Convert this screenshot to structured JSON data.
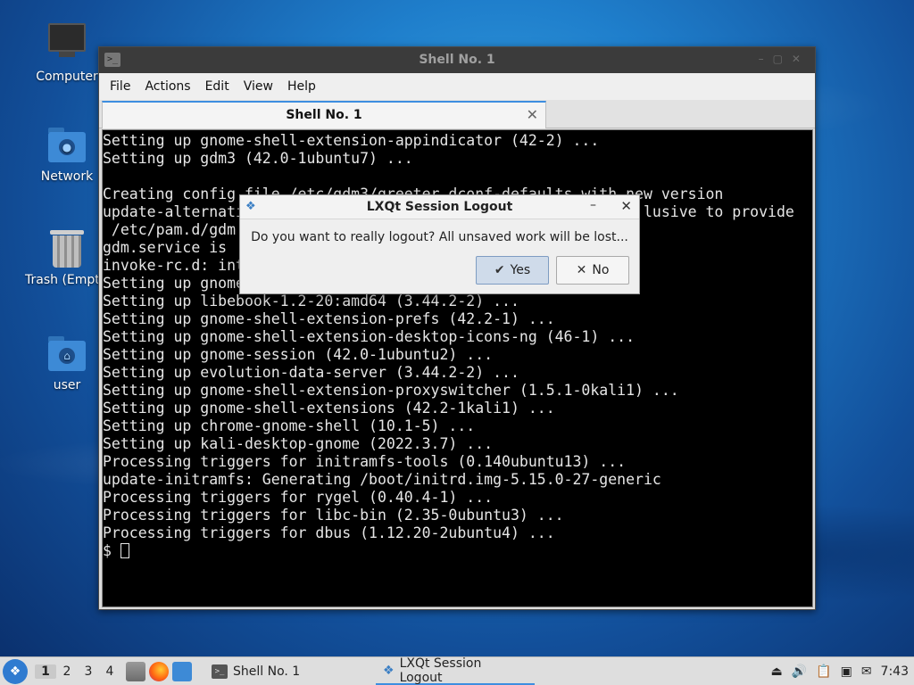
{
  "desktop": {
    "icons": [
      {
        "label": "Computer"
      },
      {
        "label": "Network"
      },
      {
        "label": "Trash (Empty)"
      },
      {
        "label": "user"
      }
    ]
  },
  "terminal": {
    "title": "Shell No. 1",
    "menu": [
      "File",
      "Actions",
      "Edit",
      "View",
      "Help"
    ],
    "tab_label": "Shell No. 1",
    "lines": [
      "Setting up gnome-shell-extension-appindicator (42-2) ...",
      "Setting up gdm3 (42.0-1ubuntu7) ...",
      "",
      "Creating config file /etc/gdm3/greeter.dconf-defaults with new version",
      "update-alternatives: using /etc/gdm3 ...                     lusive to provide",
      " /etc/pam.d/gdm",
      "gdm.service is",
      "invoke-rc.d: int",
      "Setting up gnome",
      "Setting up libebook-1.2-20:amd64 (3.44.2-2) ...",
      "Setting up gnome-shell-extension-prefs (42.2-1) ...",
      "Setting up gnome-shell-extension-desktop-icons-ng (46-1) ...",
      "Setting up gnome-session (42.0-1ubuntu2) ...",
      "Setting up evolution-data-server (3.44.2-2) ...",
      "Setting up gnome-shell-extension-proxyswitcher (1.5.1-0kali1) ...",
      "Setting up gnome-shell-extensions (42.2-1kali1) ...",
      "Setting up chrome-gnome-shell (10.1-5) ...",
      "Setting up kali-desktop-gnome (2022.3.7) ...",
      "Processing triggers for initramfs-tools (0.140ubuntu13) ...",
      "update-initramfs: Generating /boot/initrd.img-5.15.0-27-generic",
      "Processing triggers for rygel (0.40.4-1) ...",
      "Processing triggers for libc-bin (2.35-0ubuntu3) ...",
      "Processing triggers for dbus (1.12.20-2ubuntu4) ..."
    ],
    "prompt": "$ "
  },
  "dialog": {
    "title": "LXQt Session Logout",
    "message": "Do you want to really logout? All unsaved work will be lost...",
    "yes_label": "Yes",
    "no_label": "No",
    "yes_icon": "✔",
    "no_icon": "✕"
  },
  "taskbar": {
    "workspaces": [
      "1",
      "2",
      "3",
      "4"
    ],
    "tasks": [
      {
        "label": "Shell No. 1"
      },
      {
        "label": "LXQt Session Logout"
      }
    ],
    "clock": "7:43"
  }
}
